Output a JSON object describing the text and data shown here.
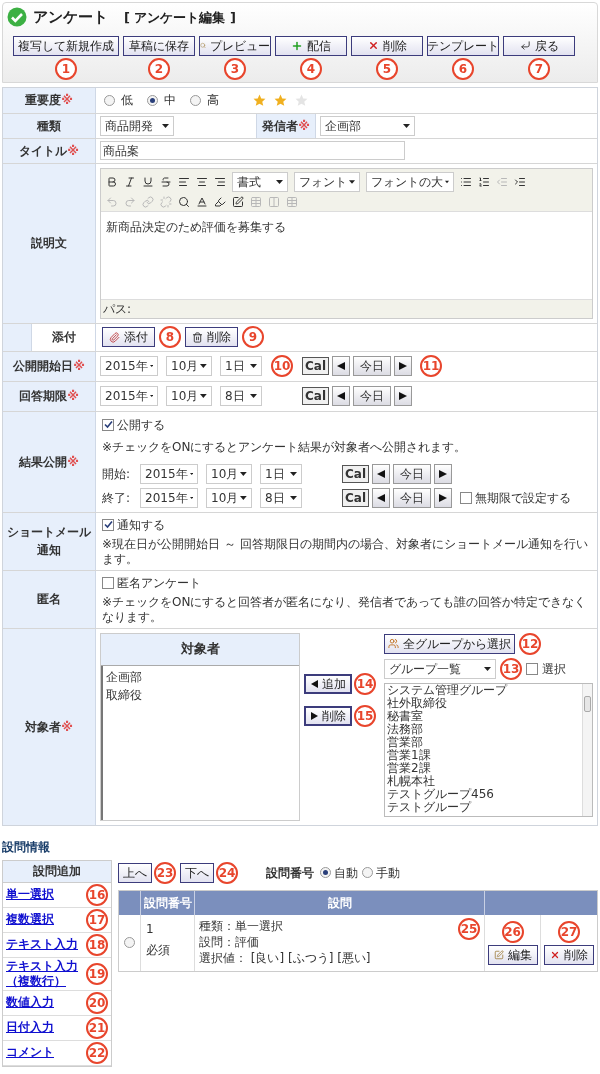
{
  "header": {
    "title": "アンケート",
    "subtitle": "[ アンケート編集 ]"
  },
  "toolbar": [
    {
      "label": "複写して新規作成",
      "callout": "1"
    },
    {
      "label": "草稿に保存",
      "callout": "2"
    },
    {
      "label": "プレビュー",
      "callout": "3"
    },
    {
      "label": "配信",
      "callout": "4"
    },
    {
      "label": "削除",
      "callout": "5"
    },
    {
      "label": "テンプレート",
      "callout": "6"
    },
    {
      "label": "戻る",
      "callout": "7"
    }
  ],
  "mark": "※",
  "importance": {
    "label": "重要度",
    "required": true,
    "options": [
      {
        "label": "低",
        "selected": false
      },
      {
        "label": "中",
        "selected": true
      },
      {
        "label": "高",
        "selected": false
      }
    ],
    "stars": 2
  },
  "category": {
    "label": "種類",
    "value": "商品開発"
  },
  "sender": {
    "label": "発信者",
    "required": true,
    "value": "企画部"
  },
  "title_field": {
    "label": "タイトル",
    "required": true,
    "value": "商品案"
  },
  "description": {
    "label": "説明文",
    "selects": [
      "書式",
      "フォント",
      "フォントの大"
    ],
    "body": "新商品決定のため評価を募集する",
    "path": "パス:"
  },
  "attachment": {
    "label": "添付",
    "buttons": [
      {
        "label": "添付",
        "callout": "8"
      },
      {
        "label": "削除",
        "callout": "9"
      }
    ]
  },
  "dates": [
    {
      "label": "公開開始日",
      "required": true,
      "year": "2015年",
      "month": "10月",
      "day": "1日",
      "cal": "Cal",
      "today": "今日",
      "callouts": [
        "10",
        "11"
      ]
    },
    {
      "label": "回答期限",
      "required": true,
      "year": "2015年",
      "month": "10月",
      "day": "8日",
      "cal": "Cal",
      "today": "今日"
    }
  ],
  "result": {
    "label": "結果公開",
    "required": true,
    "checkbox": {
      "label": "公開する",
      "checked": true
    },
    "note": "※チェックをONにするとアンケート結果が対象者へ公開されます。",
    "ranges": [
      {
        "label": "開始:",
        "year": "2015年",
        "month": "10月",
        "day": "1日",
        "cal": "Cal",
        "today": "今日"
      },
      {
        "label": "終了:",
        "year": "2015年",
        "month": "10月",
        "day": "8日",
        "cal": "Cal",
        "today": "今日"
      }
    ],
    "unlimited": {
      "label": "無期限で設定する",
      "checked": false
    }
  },
  "notify": {
    "label": "ショートメール通知",
    "checkbox": {
      "label": "通知する",
      "checked": true
    },
    "note": "※現在日が公開開始日 ～ 回答期限日の期間内の場合、対象者にショートメール通知を行います。"
  },
  "anonymous": {
    "label": "匿名",
    "checkbox": {
      "label": "匿名アンケート",
      "checked": false
    },
    "note": "※チェックをONにすると回答者が匿名になり、発信者であっても誰の回答か特定できなくなります。"
  },
  "targets": {
    "label": "対象者",
    "required": true,
    "list_title": "対象者",
    "selected_items": [
      "企画部",
      "取締役"
    ],
    "add": {
      "label": "追加",
      "callout": "14"
    },
    "remove": {
      "label": "削除",
      "callout": "15"
    },
    "select_all": {
      "label": "全グループから選択",
      "callout": "12"
    },
    "group_select": {
      "value": "グループ一覧",
      "callout": "13"
    },
    "select_check": {
      "label": "選択",
      "checked": false
    },
    "groups": [
      "システム管理グループ",
      "社外取締役",
      "秘書室",
      "法務部",
      "営業部",
      "営業1課",
      "営業2課",
      "札幌本社",
      "テストグループ456",
      "テストグループ"
    ]
  },
  "questions": {
    "title": "設問情報",
    "add_title": "設問追加",
    "add_links": [
      {
        "label": "単一選択",
        "callout": "16"
      },
      {
        "label": "複数選択",
        "callout": "17"
      },
      {
        "label": "テキスト入力",
        "callout": "18"
      },
      {
        "label": "テキスト入力（複数行）",
        "callout": "19"
      },
      {
        "label": "数値入力",
        "callout": "20"
      },
      {
        "label": "日付入力",
        "callout": "21"
      },
      {
        "label": "コメント",
        "callout": "22"
      }
    ],
    "move": [
      {
        "label": "上へ",
        "callout": "23"
      },
      {
        "label": "下へ",
        "callout": "24"
      }
    ],
    "numbering": {
      "label": "設問番号",
      "options": [
        {
          "label": "自動",
          "selected": true
        },
        {
          "label": "手動",
          "selected": false
        }
      ]
    },
    "columns": [
      "設問番号",
      "設問"
    ],
    "rows": [
      {
        "selected": false,
        "number": "1",
        "required": "必須",
        "lines": [
          "種類：単一選択",
          "設問：評価",
          "選択値： [良い] [ふつう] [悪い]"
        ],
        "callout": "25",
        "edit": {
          "label": "編集",
          "callout": "26"
        },
        "delete": {
          "label": "削除",
          "callout": "27"
        }
      }
    ]
  }
}
